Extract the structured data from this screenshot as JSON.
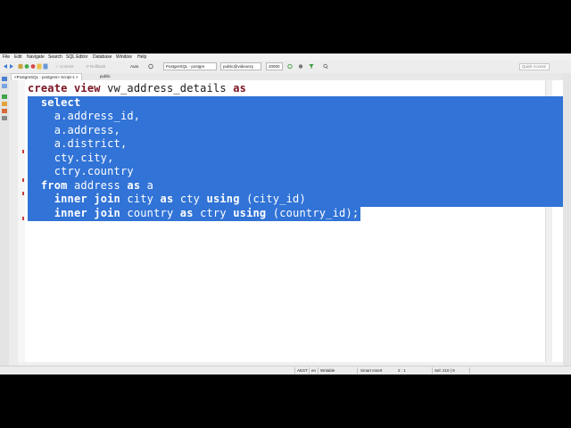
{
  "menu": [
    "File",
    "Edit",
    "Navigate",
    "Search",
    "SQL Editor",
    "Database",
    "Window",
    "Help"
  ],
  "toolbar": {
    "commit_label": "Commit",
    "rollback_label": "Rollback",
    "transaction_mode": "Auto",
    "datasource": "PostgreSQL - postgre",
    "schema": "public@videoezy",
    "fetch_size": "20000",
    "quick_access_placeholder": "Quick Access"
  },
  "tabs": [
    {
      "label": "<PostgreSQL - postgres> Script-1",
      "close": "×"
    },
    {
      "label": "public"
    }
  ],
  "editor": {
    "lines": [
      {
        "selected": false,
        "tokens": [
          {
            "t": "create",
            "k": true
          },
          {
            "t": " "
          },
          {
            "t": "view",
            "k": true
          },
          {
            "t": " vw_address_details "
          },
          {
            "t": "as",
            "k": true
          }
        ]
      },
      {
        "selected": true,
        "tokens": [
          {
            "t": "  "
          },
          {
            "t": "select",
            "k": true
          }
        ]
      },
      {
        "selected": true,
        "tokens": [
          {
            "t": "    a.address_id,"
          }
        ]
      },
      {
        "selected": true,
        "tokens": [
          {
            "t": "    a.address,"
          }
        ]
      },
      {
        "selected": true,
        "tokens": [
          {
            "t": "    a.district,"
          }
        ]
      },
      {
        "selected": true,
        "tokens": [
          {
            "t": "    cty.city,"
          }
        ]
      },
      {
        "selected": true,
        "tokens": [
          {
            "t": "    ctry.country"
          }
        ]
      },
      {
        "selected": true,
        "tokens": [
          {
            "t": "  "
          },
          {
            "t": "from",
            "k": true
          },
          {
            "t": " address "
          },
          {
            "t": "as",
            "k": true
          },
          {
            "t": " a"
          }
        ]
      },
      {
        "selected": true,
        "tokens": [
          {
            "t": "    "
          },
          {
            "t": "inner",
            "k": true
          },
          {
            "t": " "
          },
          {
            "t": "join",
            "k": true
          },
          {
            "t": " city "
          },
          {
            "t": "as",
            "k": true
          },
          {
            "t": " cty "
          },
          {
            "t": "using",
            "k": true
          },
          {
            "t": " (city_id)"
          }
        ]
      },
      {
        "selected": true,
        "tokens": [
          {
            "t": "    "
          },
          {
            "t": "inner",
            "k": true
          },
          {
            "t": " "
          },
          {
            "t": "join",
            "k": true
          },
          {
            "t": " country "
          },
          {
            "t": "as",
            "k": true
          },
          {
            "t": " ctry "
          },
          {
            "t": "using",
            "k": true
          },
          {
            "t": " (country_id);"
          }
        ]
      }
    ]
  },
  "status": {
    "timezone": "AEST",
    "locale": "en",
    "mode": "Writable",
    "insert_mode": "Smart Insert",
    "cursor": "2 : 1",
    "selection": "Sel: 210 | 9"
  },
  "colors": {
    "selection": "#3173d6",
    "keyword": "#7a1424",
    "error_marker": "#c63e3e"
  },
  "icons": {
    "toolbar": [
      "back-icon",
      "forward-icon",
      "datasource-icon",
      "connect-icon",
      "disconnect-icon",
      "sql-editor-icon",
      "new-script-icon"
    ],
    "leftbar": [
      "database-navigator-icon",
      "projects-icon",
      "execute-icon",
      "explain-icon",
      "format-icon",
      "outline-icon"
    ]
  }
}
